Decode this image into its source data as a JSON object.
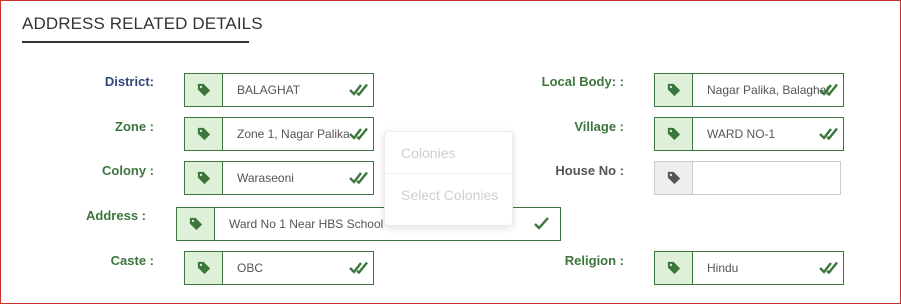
{
  "section": {
    "title": "ADDRESS RELATED DETAILS"
  },
  "fields": {
    "district": {
      "label": "District:",
      "value": "BALAGHAT"
    },
    "local_body": {
      "label": "Local Body: :",
      "value": "Nagar Palika, Balaghat"
    },
    "zone": {
      "label": "Zone :",
      "value": "Zone 1, Nagar Palika"
    },
    "village": {
      "label": "Village :",
      "value": "WARD NO-1"
    },
    "colony": {
      "label": "Colony :",
      "value": "Waraseoni"
    },
    "house_no": {
      "label": "House No :",
      "value": ""
    },
    "address": {
      "label": "Address :",
      "value": "Ward No 1 Near HBS School"
    },
    "caste": {
      "label": "Caste :",
      "value": "OBC"
    },
    "religion": {
      "label": "Religion :",
      "value": "Hindu"
    }
  },
  "colony_dropdown": {
    "options": [
      "Colonies",
      "Select Colonies"
    ]
  },
  "icons": {
    "addon": "tag-icon",
    "valid": "double-check-icon"
  },
  "colors": {
    "success": "#3c763d",
    "success_bg": "#dff0d8",
    "district_label": "#31487a",
    "panel_border": "#c9302c"
  }
}
